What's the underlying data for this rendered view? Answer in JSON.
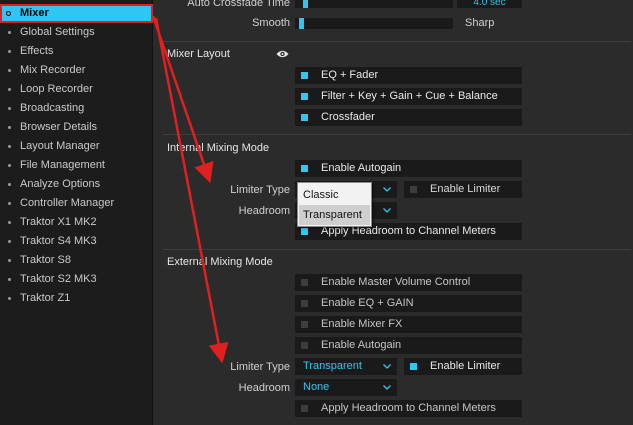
{
  "sidebar": {
    "items": [
      {
        "label": "Mixer"
      },
      {
        "label": "Global Settings"
      },
      {
        "label": "Effects"
      },
      {
        "label": "Mix Recorder"
      },
      {
        "label": "Loop Recorder"
      },
      {
        "label": "Broadcasting"
      },
      {
        "label": "Browser Details"
      },
      {
        "label": "Layout Manager"
      },
      {
        "label": "File Management"
      },
      {
        "label": "Analyze Options"
      },
      {
        "label": "Controller Manager"
      },
      {
        "label": "Traktor X1 MK2"
      },
      {
        "label": "Traktor S4 MK3"
      },
      {
        "label": "Traktor S8"
      },
      {
        "label": "Traktor S2 MK3"
      },
      {
        "label": "Traktor Z1"
      }
    ]
  },
  "crossfade": {
    "time_label": "Auto Crossfade Time",
    "time_value": "4.0 sec",
    "smooth_label": "Smooth",
    "sharp_label": "Sharp",
    "level": 0.04
  },
  "mixer_layout": {
    "title": "Mixer Layout",
    "options": [
      {
        "label": "EQ + Fader",
        "checked": true
      },
      {
        "label": "Filter + Key + Gain + Cue + Balance",
        "checked": true
      },
      {
        "label": "Crossfader",
        "checked": true
      }
    ]
  },
  "internal": {
    "title": "Internal Mixing Mode",
    "enable_autogain": "Enable Autogain",
    "limiter_type_label": "Limiter Type",
    "enable_limiter": "Enable Limiter",
    "headroom_label": "Headroom",
    "apply_headroom": "Apply Headroom to Channel Meters",
    "popup_options": [
      "Classic",
      "Transparent"
    ]
  },
  "external": {
    "title": "External Mixing Mode",
    "enable_master_volume": "Enable Master Volume Control",
    "enable_eq_gain": "Enable EQ + GAIN",
    "enable_mixer_fx": "Enable Mixer FX",
    "enable_autogain": "Enable Autogain",
    "limiter_type_label": "Limiter Type",
    "limiter_type_value": "Transparent",
    "enable_limiter": "Enable Limiter",
    "headroom_label": "Headroom",
    "headroom_value": "None",
    "apply_headroom": "Apply Headroom to Channel Meters"
  },
  "colors": {
    "accent": "#2fc6f2",
    "annotation": "#e02020",
    "background": "#2b2b2b",
    "sidebar": "#1c1c1c"
  }
}
